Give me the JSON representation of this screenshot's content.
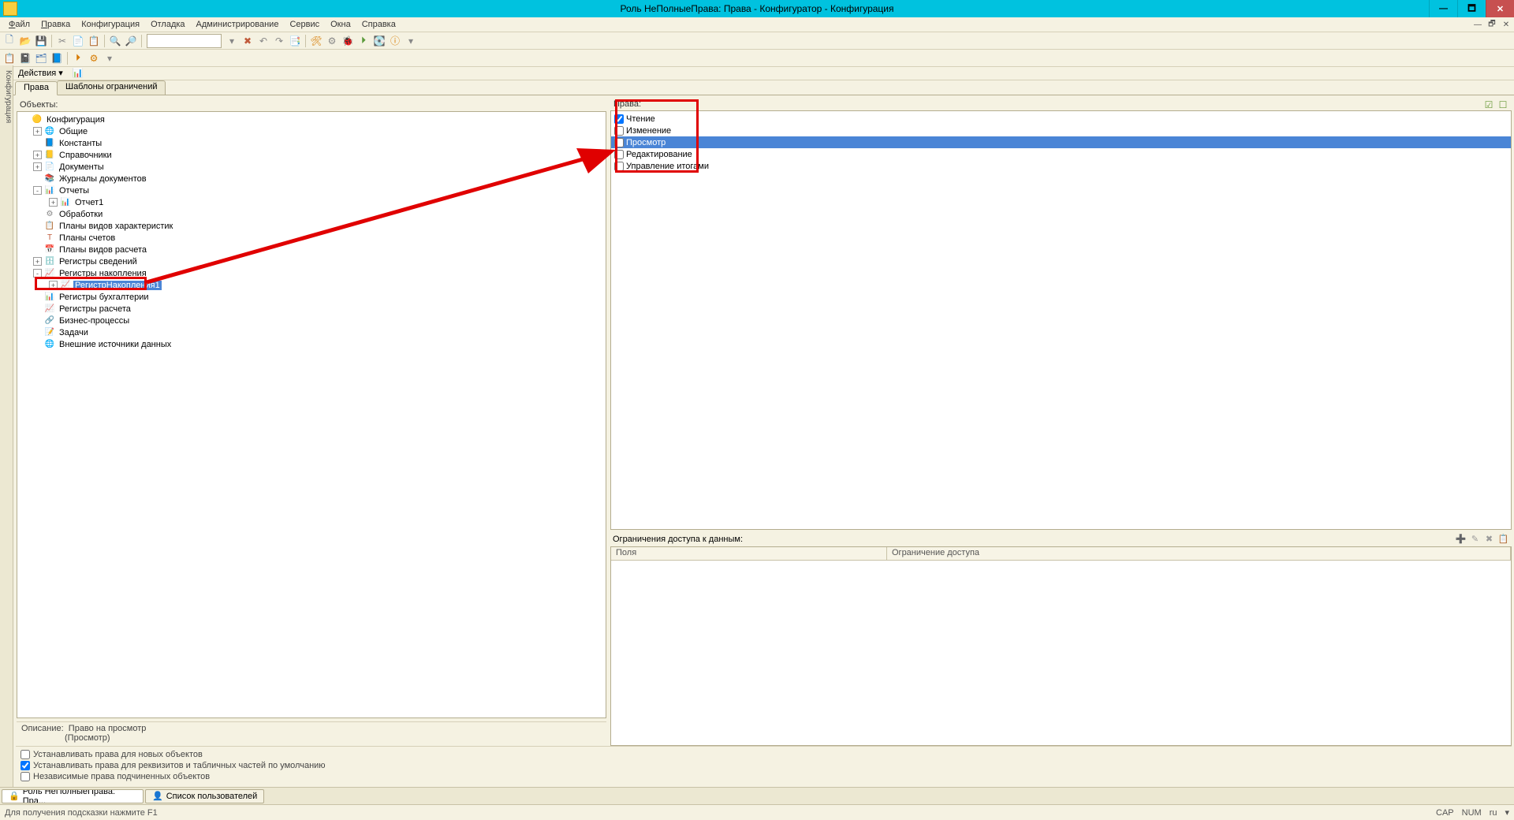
{
  "titlebar": {
    "title": "Роль НеПолныеПрава: Права - Конфигуратор - Конфигурация"
  },
  "menu": [
    "Файл",
    "Правка",
    "Конфигурация",
    "Отладка",
    "Администрирование",
    "Сервис",
    "Окна",
    "Справка"
  ],
  "toolbar1_icons": [
    "📄",
    "📁",
    "💾",
    "📋",
    "✂",
    "📄",
    "📋",
    "🔍",
    "🔍",
    "🔎",
    "",
    "▾",
    "✖",
    "↶",
    "↷",
    "📑",
    "",
    "🛠",
    "⚙",
    "🐞",
    "⏵",
    "🟦",
    "💽",
    "ℹ"
  ],
  "toolbar2_icons": [
    "📋",
    "📓",
    "🗂",
    "📘",
    "⏵",
    "⚙"
  ],
  "actionbar": {
    "label": "Действия",
    "icon": "📊"
  },
  "tabs": [
    {
      "label": "Права",
      "active": true
    },
    {
      "label": "Шаблоны ограничений",
      "active": false
    }
  ],
  "left_label": "Объекты:",
  "tree": [
    {
      "lvl": 0,
      "exp": "",
      "icon": "🟡",
      "label": "Конфигурация",
      "ic": "i-yellow"
    },
    {
      "lvl": 1,
      "exp": "+",
      "icon": "🌐",
      "label": "Общие",
      "ic": "i-green"
    },
    {
      "lvl": 1,
      "exp": "",
      "icon": "📘",
      "label": "Константы",
      "ic": "i-blue"
    },
    {
      "lvl": 1,
      "exp": "+",
      "icon": "📒",
      "label": "Справочники",
      "ic": "i-orange"
    },
    {
      "lvl": 1,
      "exp": "+",
      "icon": "📄",
      "label": "Документы",
      "ic": "i-blue"
    },
    {
      "lvl": 1,
      "exp": "",
      "icon": "📚",
      "label": "Журналы документов",
      "ic": "i-blue"
    },
    {
      "lvl": 1,
      "exp": "-",
      "icon": "📊",
      "label": "Отчеты",
      "ic": "i-orange"
    },
    {
      "lvl": 2,
      "exp": "+",
      "icon": "📊",
      "label": "Отчет1",
      "ic": "i-orange"
    },
    {
      "lvl": 1,
      "exp": "",
      "icon": "⚙",
      "label": "Обработки",
      "ic": "i-gray"
    },
    {
      "lvl": 1,
      "exp": "",
      "icon": "📋",
      "label": "Планы видов характеристик",
      "ic": "i-blue"
    },
    {
      "lvl": 1,
      "exp": "",
      "icon": "Т",
      "label": "Планы счетов",
      "ic": "i-red"
    },
    {
      "lvl": 1,
      "exp": "",
      "icon": "📅",
      "label": "Планы видов расчета",
      "ic": "i-blue"
    },
    {
      "lvl": 1,
      "exp": "+",
      "icon": "🗄",
      "label": "Регистры сведений",
      "ic": "i-teal"
    },
    {
      "lvl": 1,
      "exp": "-",
      "icon": "📈",
      "label": "Регистры накопления",
      "ic": "i-orange"
    },
    {
      "lvl": 2,
      "exp": "+",
      "icon": "📈",
      "label": "РегистрНакопления1",
      "ic": "i-orange",
      "selected": true
    },
    {
      "lvl": 1,
      "exp": "",
      "icon": "📊",
      "label": "Регистры бухгалтерии",
      "ic": "i-green"
    },
    {
      "lvl": 1,
      "exp": "",
      "icon": "📈",
      "label": "Регистры расчета",
      "ic": "i-blue"
    },
    {
      "lvl": 1,
      "exp": "",
      "icon": "🔗",
      "label": "Бизнес-процессы",
      "ic": "i-purple"
    },
    {
      "lvl": 1,
      "exp": "",
      "icon": "📝",
      "label": "Задачи",
      "ic": "i-blue"
    },
    {
      "lvl": 1,
      "exp": "",
      "icon": "🌐",
      "label": "Внешние источники данных",
      "ic": "i-teal"
    }
  ],
  "rights_label": "Права:",
  "rights": [
    {
      "label": "Чтение",
      "checked": true,
      "selected": false
    },
    {
      "label": "Изменение",
      "checked": false,
      "selected": false
    },
    {
      "label": "Просмотр",
      "checked": false,
      "selected": true
    },
    {
      "label": "Редактирование",
      "checked": false,
      "selected": false
    },
    {
      "label": "Управление итогами",
      "checked": false,
      "selected": false
    }
  ],
  "restrictions": {
    "label": "Ограничения доступа к данным:",
    "col1": "Поля",
    "col2": "Ограничение доступа"
  },
  "description": {
    "label": "Описание:",
    "line1": "Право на просмотр",
    "line2": "(Просмотр)"
  },
  "options": [
    {
      "label": "Устанавливать права для новых объектов",
      "checked": false
    },
    {
      "label": "Устанавливать права для реквизитов и табличных частей по умолчанию",
      "checked": true
    },
    {
      "label": "Независимые права подчиненных объектов",
      "checked": false
    }
  ],
  "sidebar_tab": "Конфигурация",
  "wintabs": [
    {
      "label": "Роль НеПолныеПрава: Пра...",
      "active": true,
      "icon": "🔒"
    },
    {
      "label": "Список пользователей",
      "active": false,
      "icon": "👤"
    }
  ],
  "status": {
    "left": "Для получения подсказки нажмите F1",
    "cap": "CAP",
    "num": "NUM",
    "lang": "ru"
  }
}
